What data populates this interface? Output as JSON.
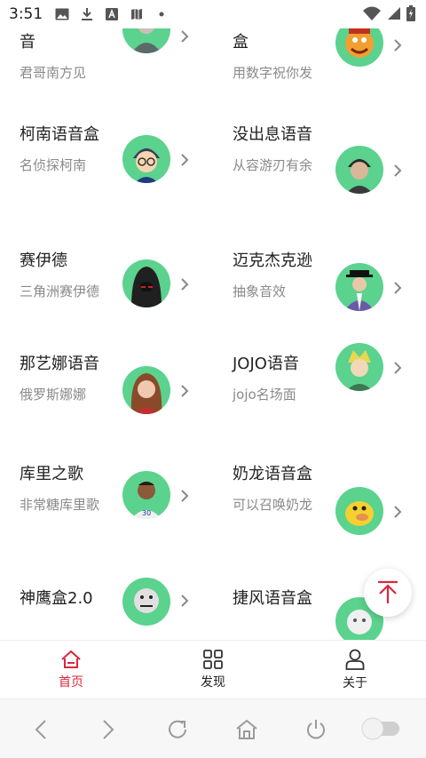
{
  "status_bar": {
    "time": "3:51"
  },
  "cards": [
    {
      "title": "音",
      "subtitle": "君哥南方见"
    },
    {
      "title": "盒",
      "subtitle": "用数字祝你发"
    },
    {
      "title": "柯南语音盒",
      "subtitle": "名侦探柯南"
    },
    {
      "title": "没出息语音",
      "subtitle": "从容游刃有余"
    },
    {
      "title": "赛伊德",
      "subtitle": "三角洲赛伊德"
    },
    {
      "title": "迈克杰克逊",
      "subtitle": "抽象音效"
    },
    {
      "title": "那艺娜语音",
      "subtitle": "俄罗斯娜娜"
    },
    {
      "title": "JOJO语音",
      "subtitle": "jojo名场面"
    },
    {
      "title": "库里之歌",
      "subtitle": "非常糖库里歌"
    },
    {
      "title": "奶龙语音盒",
      "subtitle": "可以召唤奶龙"
    },
    {
      "title": "神鹰盒2.0",
      "subtitle": ""
    },
    {
      "title": "捷风语音盒",
      "subtitle": ""
    }
  ],
  "tabs": {
    "home": "首页",
    "discover": "发现",
    "about": "关于"
  },
  "colors": {
    "accent": "#d9283d",
    "avatar_bg": "#5bd28e",
    "subtitle": "#8a8a8a"
  }
}
